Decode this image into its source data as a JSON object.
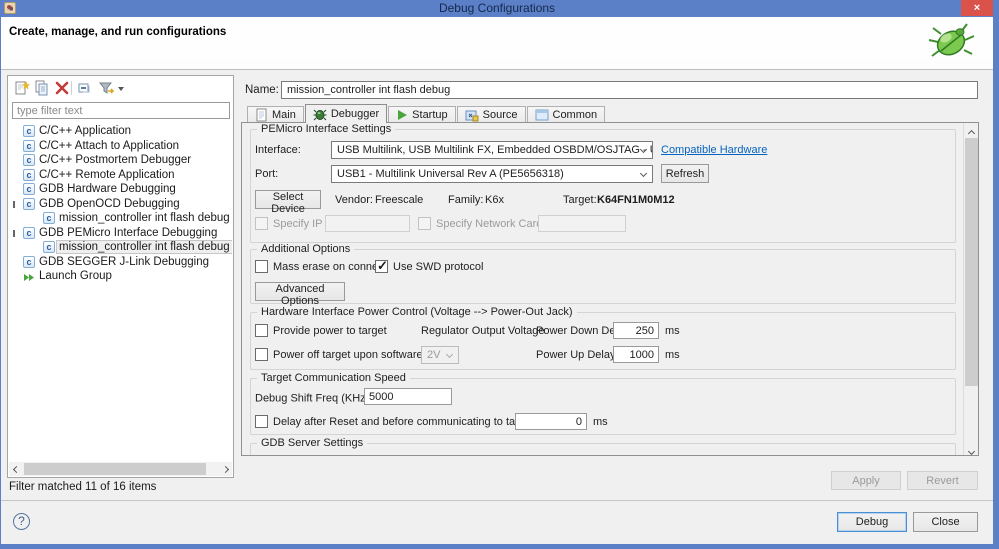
{
  "window": {
    "title": "Debug Configurations",
    "close_glyph": "×"
  },
  "header": {
    "title": "Create, manage, and run configurations"
  },
  "sidebar": {
    "filter_placeholder": "type filter text",
    "status": "Filter matched 11 of 16 items",
    "tree": [
      {
        "label": "C/C++ Application"
      },
      {
        "label": "C/C++ Attach to Application"
      },
      {
        "label": "C/C++ Postmortem Debugger"
      },
      {
        "label": "C/C++ Remote Application"
      },
      {
        "label": "GDB Hardware Debugging"
      },
      {
        "label": "GDB OpenOCD Debugging"
      },
      {
        "label": "mission_controller int flash debug cmsisdap"
      },
      {
        "label": "GDB PEMicro Interface Debugging"
      },
      {
        "label": "mission_controller int flash debug"
      },
      {
        "label": "GDB SEGGER J-Link Debugging"
      },
      {
        "label": "Launch Group"
      }
    ]
  },
  "main": {
    "name_label": "Name:",
    "name_value": "mission_controller int flash debug",
    "tabs": [
      {
        "label": "Main"
      },
      {
        "label": "Debugger"
      },
      {
        "label": "Startup"
      },
      {
        "label": "Source"
      },
      {
        "label": "Common"
      }
    ],
    "pemicro": {
      "title": "PEMicro Interface Settings",
      "interface_label": "Interface:",
      "interface_value": "USB Multilink, USB Multilink FX, Embedded OSBDM/OSJTAG - USB Port",
      "compatible_link": "Compatible Hardware",
      "port_label": "Port:",
      "port_value": "USB1 - Multilink Universal Rev A (PE5656318)",
      "refresh_button": "Refresh",
      "select_device_button": "Select Device",
      "vendor_label": "Vendor:",
      "vendor_value": "Freescale",
      "family_label": "Family:",
      "family_value": "K6x",
      "target_label": "Target:",
      "target_value": "K64FN1M0M12",
      "specify_ip_label": "Specify IP",
      "specify_network_label": "Specify Network Card IP"
    },
    "additional": {
      "title": "Additional Options",
      "mass_erase_label": "Mass erase on connect",
      "swd_label": "Use SWD protocol",
      "advanced_button": "Advanced Options"
    },
    "power": {
      "title": "Hardware Interface Power Control (Voltage --> Power-Out Jack)",
      "provide_label": "Provide power to target",
      "regulator_label": "Regulator Output Voltage",
      "down_label": "Power Down Delay",
      "down_value": "250",
      "down_unit": "ms",
      "off_label": "Power off target upon software exit",
      "voltage_value": "2V",
      "up_label": "Power Up Delay",
      "up_value": "1000",
      "up_unit": "ms"
    },
    "speed": {
      "title": "Target Communication Speed",
      "freq_label": "Debug Shift Freq (KHz)",
      "freq_info": "i",
      "freq_value": "5000",
      "delay_label": "Delay after Reset and before communicating to target for",
      "delay_value": "0",
      "delay_unit": "ms"
    },
    "gdb": {
      "title": "GDB Server Settings"
    },
    "apply_button": "Apply",
    "revert_button": "Revert"
  },
  "footer": {
    "debug_button": "Debug",
    "close_button": "Close"
  },
  "colors": {
    "titlebar": "#5b80c8",
    "close_button": "#d9534a",
    "link": "#0563c1"
  }
}
